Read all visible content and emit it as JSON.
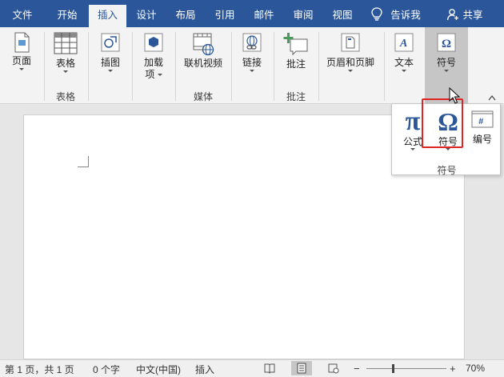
{
  "tabs": [
    {
      "label": "文件",
      "active": false
    },
    {
      "label": "开始",
      "active": false
    },
    {
      "label": "插入",
      "active": true
    },
    {
      "label": "设计",
      "active": false
    },
    {
      "label": "布局",
      "active": false
    },
    {
      "label": "引用",
      "active": false
    },
    {
      "label": "邮件",
      "active": false
    },
    {
      "label": "审阅",
      "active": false
    },
    {
      "label": "视图",
      "active": false
    }
  ],
  "tell_me": "告诉我",
  "share": "共享",
  "ribbon": {
    "page": "页面",
    "table": "表格",
    "table_group": "表格",
    "illustrations": "插图",
    "addins_line1": "加载",
    "addins_line2": "项",
    "online_video": "联机视频",
    "media_group": "媒体",
    "links": "链接",
    "comment": "批注",
    "comment_group": "批注",
    "header_footer": "页眉和页脚",
    "text": "文本",
    "symbols": "符号"
  },
  "dropdown": {
    "equation": "公式",
    "symbol": "符号",
    "number": "编号",
    "group_label": "符号",
    "pi_glyph": "π",
    "omega_glyph": "Ω"
  },
  "status": {
    "page": "第 1 页，共 1 页",
    "words": "0 个字",
    "language": "中文(中国)",
    "mode": "插入",
    "zoom_minus": "−",
    "zoom_plus": "+",
    "zoom_value": "70%",
    "zoom_level": 70
  },
  "colors": {
    "accent": "#2b579a",
    "highlight": "#e02424",
    "ribbon_bg": "#f3f3f3"
  }
}
